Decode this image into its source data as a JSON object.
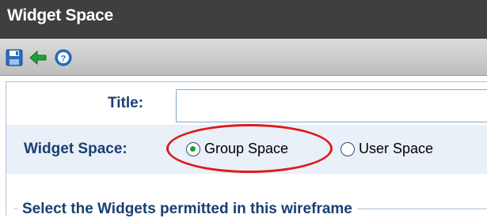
{
  "window": {
    "title": "Widget Space"
  },
  "toolbar": {
    "icons": [
      "save-icon",
      "back-arrow-icon",
      "help-icon"
    ],
    "colors": {
      "save": "#2b6cc4",
      "back": "#1fa03a",
      "help": "#2f6fd0"
    }
  },
  "form": {
    "title_label": "Title:",
    "title_value": "",
    "widget_space_label": "Widget Space:",
    "options": [
      {
        "label": "Group Space",
        "selected": true
      },
      {
        "label": "User Space",
        "selected": false
      }
    ],
    "section_heading": "Select the Widgets permitted in this wireframe"
  },
  "annotation": {
    "shape": "ellipse",
    "color": "#e01a1a",
    "target": "Group Space"
  }
}
